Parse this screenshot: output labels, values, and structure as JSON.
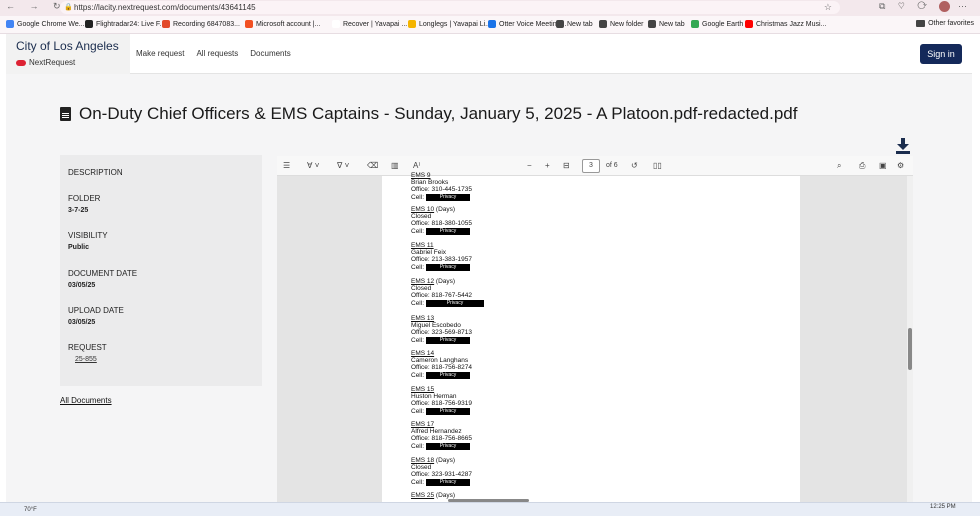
{
  "browser": {
    "url": "https://lacity.nextrequest.com/documents/43641145",
    "bookmarks": [
      {
        "label": "Google Chrome We...",
        "color": "#4285f4"
      },
      {
        "label": "Flightradar24: Live F...",
        "color": "#222222"
      },
      {
        "label": "Recording 6847083...",
        "color": "#e24a2b"
      },
      {
        "label": "Microsoft account |...",
        "color": "#f25022"
      },
      {
        "label": "Recover | Yavapai ...",
        "color": "#ffffff"
      },
      {
        "label": "Longlegs | Yavapai Li...",
        "color": "#f4b400"
      },
      {
        "label": "Otter Voice Meeting...",
        "color": "#1a73e8"
      },
      {
        "label": "New tab",
        "color": "#444444"
      },
      {
        "label": "New folder",
        "color": "#444444"
      },
      {
        "label": "New tab",
        "color": "#444444"
      },
      {
        "label": "Google Earth",
        "color": "#34a853"
      },
      {
        "label": "Christmas Jazz Musi...",
        "color": "#ff0000"
      }
    ],
    "other_favorites": "Other favorites"
  },
  "header": {
    "city": "City of Los Angeles",
    "brand": "NextRequest",
    "nav": [
      "Make request",
      "All requests",
      "Documents"
    ],
    "sign_in": "Sign in"
  },
  "document": {
    "title": "On-Duty Chief Officers & EMS Captains - Sunday, January 5, 2025 - A Platoon.pdf-redacted.pdf"
  },
  "sidebar": {
    "description_label": "DESCRIPTION",
    "folder_label": "FOLDER",
    "folder_value": "3-7-25",
    "visibility_label": "VISIBILITY",
    "visibility_value": "Public",
    "document_date_label": "DOCUMENT DATE",
    "document_date_value": "03/05/25",
    "upload_date_label": "UPLOAD DATE",
    "upload_date_value": "03/05/25",
    "request_label": "REQUEST",
    "request_value": "25-855",
    "all_documents": "All Documents"
  },
  "viewer": {
    "page_current": "3",
    "page_total": "of 6",
    "redaction_label": "Privacy",
    "entries": [
      {
        "header": "EMS 9",
        "lines": [
          "Brian Brooks",
          "Office: 310-445-1735"
        ],
        "cell": true
      },
      {
        "header": "EMS 10",
        "suffix": " (Days)",
        "lines": [
          "Closed",
          "Office: 818-380-1055"
        ],
        "cell": true
      },
      {
        "header": "EMS 11",
        "lines": [
          "Gabriel Feix",
          "Office: 213-383-1957"
        ],
        "cell": true
      },
      {
        "header": "EMS 12",
        "suffix": " (Days)",
        "lines": [
          "Closed",
          "Office: 818-767-5442"
        ],
        "cell": true
      },
      {
        "header": "EMS 13",
        "lines": [
          "Miguel Escobedo",
          "Office: 323-569-8713"
        ],
        "cell": true
      },
      {
        "header": "EMS 14",
        "lines": [
          "Cameron Langhans",
          "Office: 818-756-8274"
        ],
        "cell": true
      },
      {
        "header": "EMS 15",
        "lines": [
          "Huston Herman",
          "Office: 818-756-9319"
        ],
        "cell": true
      },
      {
        "header": "EMS 17",
        "lines": [
          "Alfred Hernandez",
          "Office: 818-756-8665"
        ],
        "cell": true
      },
      {
        "header": "EMS 18",
        "suffix": " (Days)",
        "lines": [
          "Closed",
          "Office: 323-931-4287"
        ],
        "cell": true
      },
      {
        "header": "EMS 25",
        "suffix": " (Days)",
        "lines": [],
        "cell": false
      }
    ],
    "cell_label": "Cell:"
  },
  "taskbar": {
    "weather": "70°F",
    "time": "12:25 PM"
  }
}
